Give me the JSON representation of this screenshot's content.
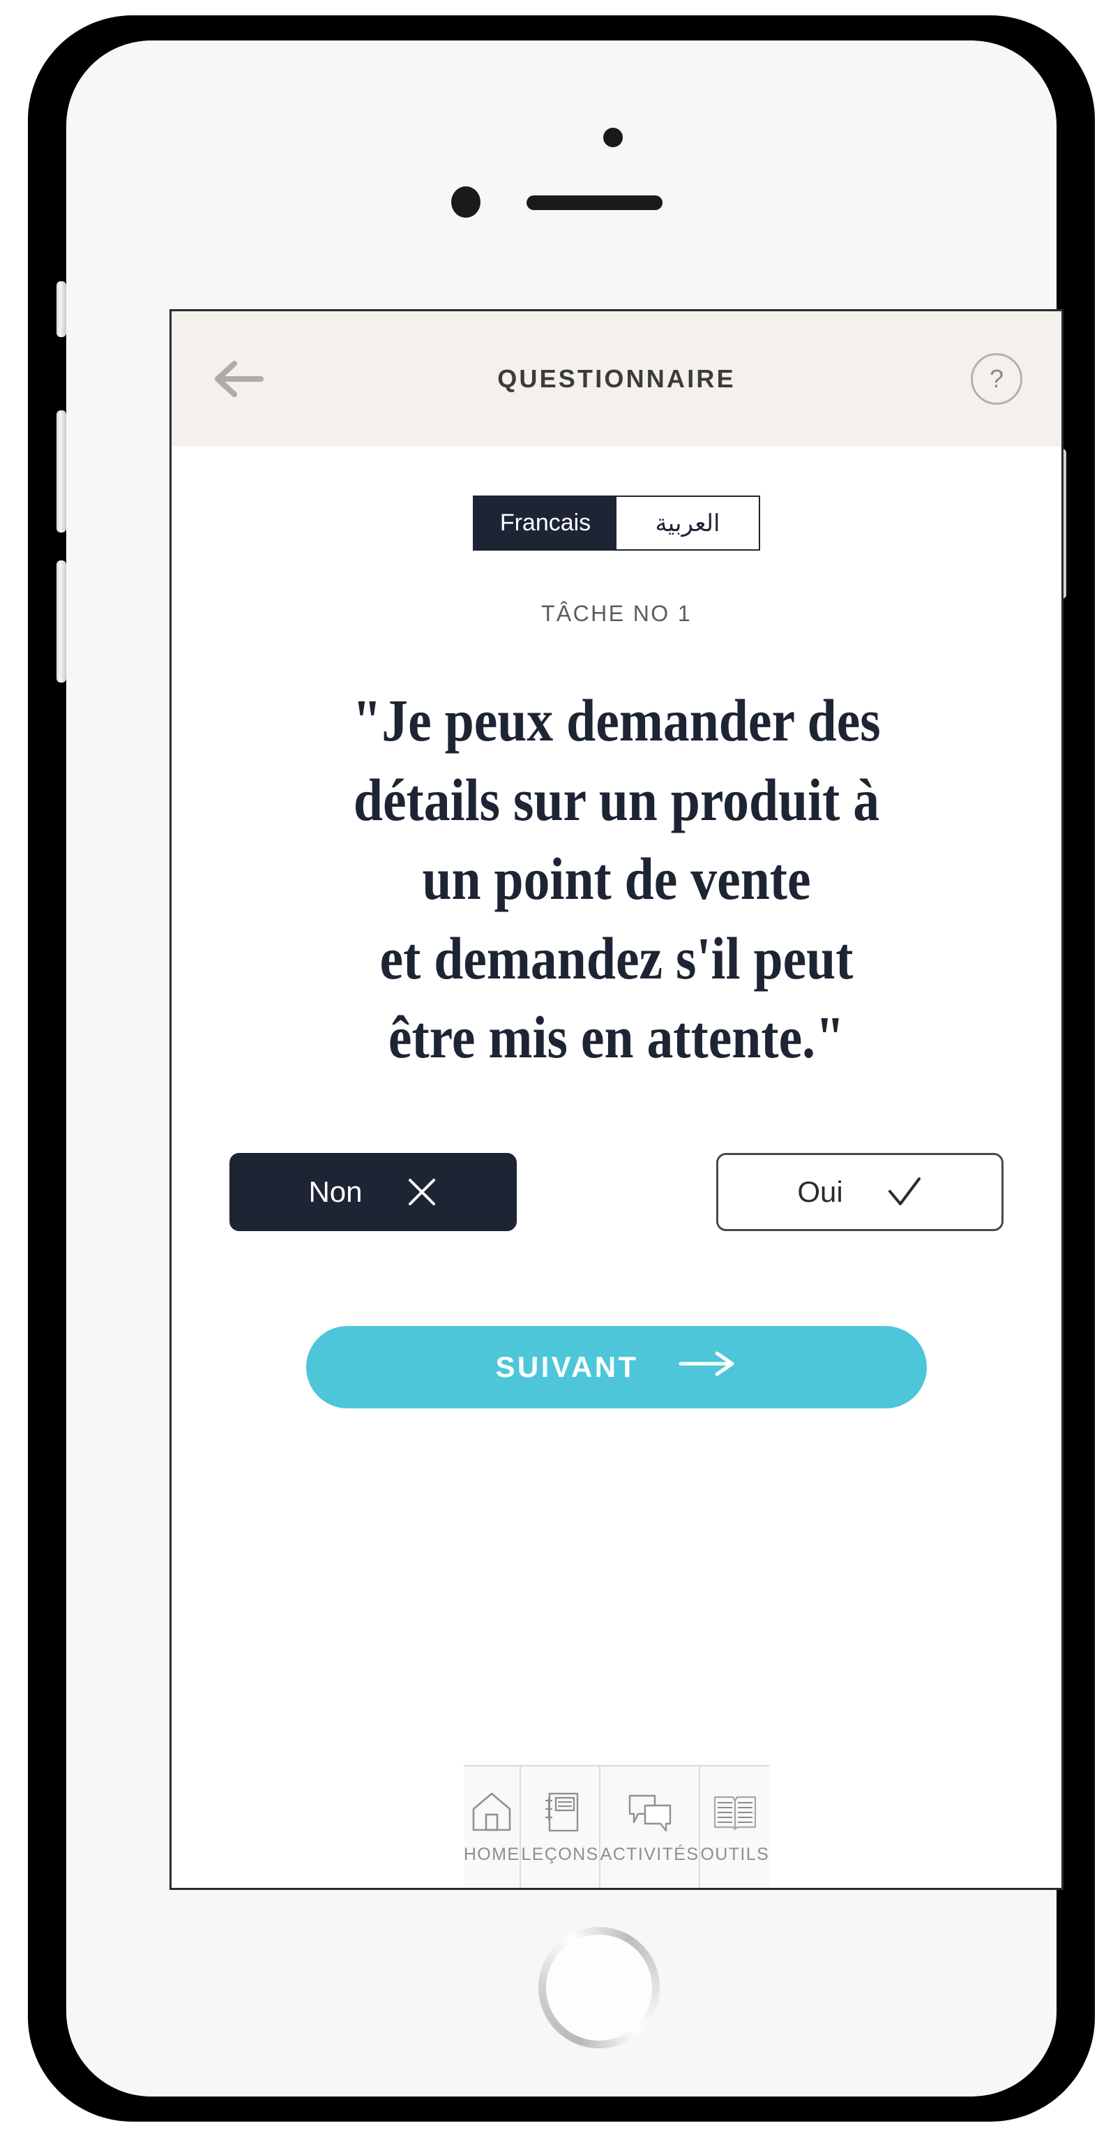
{
  "device": {
    "type": "smartphone-mockup",
    "frame_color": "#000000",
    "body_color": "#f7f7f7"
  },
  "header": {
    "title": "QUESTIONNAIRE",
    "back_icon": "arrow-left-icon",
    "help_label": "?",
    "background": "#f4f0eb"
  },
  "language_toggle": {
    "options": [
      {
        "label": "Francais",
        "active": true
      },
      {
        "label": "العربية",
        "active": false
      }
    ],
    "active_color": "#1d2433"
  },
  "task": {
    "label": "TÂCHE NO 1"
  },
  "question": {
    "text": "\"Je peux demander des détails sur un produit à un point de vente et demandez s'il peut être mis en attente.\"",
    "lines": [
      "\"Je peux demander des",
      "détails sur un produit à",
      "un point de vente",
      "et demandez s'il peut",
      "être mis en attente.\""
    ],
    "color": "#1d2433"
  },
  "answers": [
    {
      "label": "Non",
      "icon": "close-x-icon",
      "selected": true
    },
    {
      "label": "Oui",
      "icon": "check-icon",
      "selected": false
    }
  ],
  "next_button": {
    "label": "SUIVANT",
    "icon": "arrow-right-icon",
    "color": "#4cc6d8"
  },
  "bottom_nav": {
    "items": [
      {
        "label": "HOME",
        "icon": "home-icon"
      },
      {
        "label": "LEÇONS",
        "icon": "notebook-icon"
      },
      {
        "label": "ACTIVITÉS",
        "icon": "chat-bubbles-icon"
      },
      {
        "label": "OUTILS",
        "icon": "open-book-icon"
      }
    ]
  }
}
